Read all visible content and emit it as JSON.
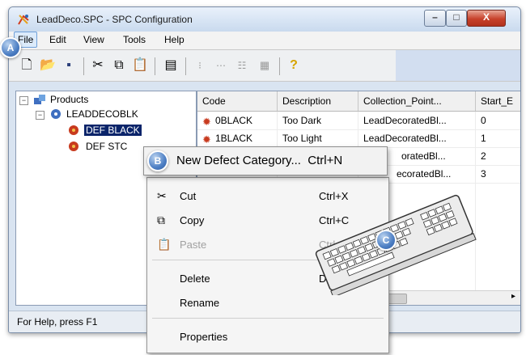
{
  "window": {
    "title": "LeadDeco.SPC - SPC Configuration",
    "controls": {
      "minimize": "–",
      "maximize": "□",
      "close": "X"
    }
  },
  "menubar": [
    "File",
    "Edit",
    "View",
    "Tools",
    "Help"
  ],
  "toolbar": {
    "icons": [
      "new-icon",
      "open-icon",
      "save-icon",
      "cut-icon",
      "copy-icon",
      "paste-icon",
      "properties-icon",
      "tree-icon-1",
      "tree-icon-2",
      "tree-icon-3",
      "grid-icon",
      "help-icon"
    ]
  },
  "tree": {
    "root": "Products",
    "child": "LEADDECOBLK",
    "items": [
      "DEF BLACK",
      "DEF STC"
    ]
  },
  "list": {
    "columns": [
      "Code",
      "Description",
      "Collection_Point...",
      "Start_E"
    ],
    "rows": [
      {
        "code": "0BLACK",
        "description": "Too Dark",
        "collection_point": "LeadDecoratedBl...",
        "start": "0"
      },
      {
        "code": "1BLACK",
        "description": "Too Light",
        "collection_point": "LeadDecoratedBl...",
        "start": "1"
      },
      {
        "code": "",
        "description": "",
        "collection_point": "oratedBl...",
        "start": "2"
      },
      {
        "code": "",
        "description": "",
        "collection_point": "ecoratedBl...",
        "start": "3"
      }
    ]
  },
  "status": {
    "text": "For Help, press F1"
  },
  "popup": {
    "label": "New Defect Category...",
    "shortcut": "Ctrl+N"
  },
  "context_menu": {
    "items": [
      {
        "label": "Cut",
        "shortcut": "Ctrl+X",
        "icon": "scissors-icon",
        "disabled": false
      },
      {
        "label": "Copy",
        "shortcut": "Ctrl+C",
        "icon": "copy-icon",
        "disabled": false
      },
      {
        "label": "Paste",
        "shortcut": "Ctrl+V",
        "icon": "paste-icon",
        "disabled": true
      },
      {
        "label": "Delete",
        "shortcut": "Del",
        "disabled": false
      },
      {
        "label": "Rename",
        "shortcut": "",
        "disabled": false
      },
      {
        "label": "Properties",
        "shortcut": "",
        "disabled": false
      }
    ]
  },
  "callouts": {
    "a": "A",
    "b": "B",
    "c": "C"
  },
  "colors": {
    "selection": "#0a246a",
    "callout": "#4d7fc4",
    "titlebar": "#c9daee"
  }
}
